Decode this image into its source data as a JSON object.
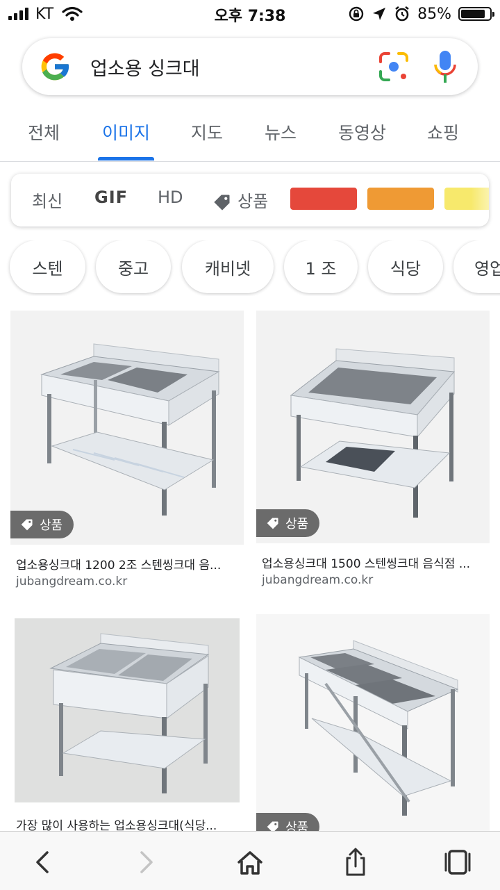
{
  "status_bar": {
    "carrier": "KT",
    "time": "오후 7:38",
    "battery_percent": "85%",
    "battery_level": 0.85
  },
  "search": {
    "query": "업소용 싱크대"
  },
  "tabs": [
    {
      "label": "전체",
      "active": false
    },
    {
      "label": "이미지",
      "active": true
    },
    {
      "label": "지도",
      "active": false
    },
    {
      "label": "뉴스",
      "active": false
    },
    {
      "label": "동영상",
      "active": false
    },
    {
      "label": "쇼핑",
      "active": false
    }
  ],
  "filters": {
    "recent": "최신",
    "gif": "GIF",
    "hd": "HD",
    "product": "상품",
    "colors": [
      "#e5483b",
      "#ef9a34",
      "#f7e96c"
    ]
  },
  "chips": [
    "스텐",
    "중고",
    "캐비넷",
    "1 조",
    "식당",
    "영업"
  ],
  "results": [
    {
      "badge": "상품",
      "title": "업소용싱크대 1200 2조 스텐씽크대 음...",
      "source": "jubangdream.co.kr"
    },
    {
      "badge": "상품",
      "title": "업소용싱크대 1500 스텐씽크대 음식점 ...",
      "source": "jubangdream.co.kr"
    },
    {
      "badge": "",
      "title": "가장 많이 사용하는 업소용싱크대(식당...",
      "source": ""
    },
    {
      "badge": "상품",
      "title": "",
      "source": ""
    }
  ],
  "toolbar": {
    "back": "back-icon",
    "forward": "forward-icon",
    "home": "home-icon",
    "share": "share-icon",
    "tabs": "tabs-icon"
  }
}
